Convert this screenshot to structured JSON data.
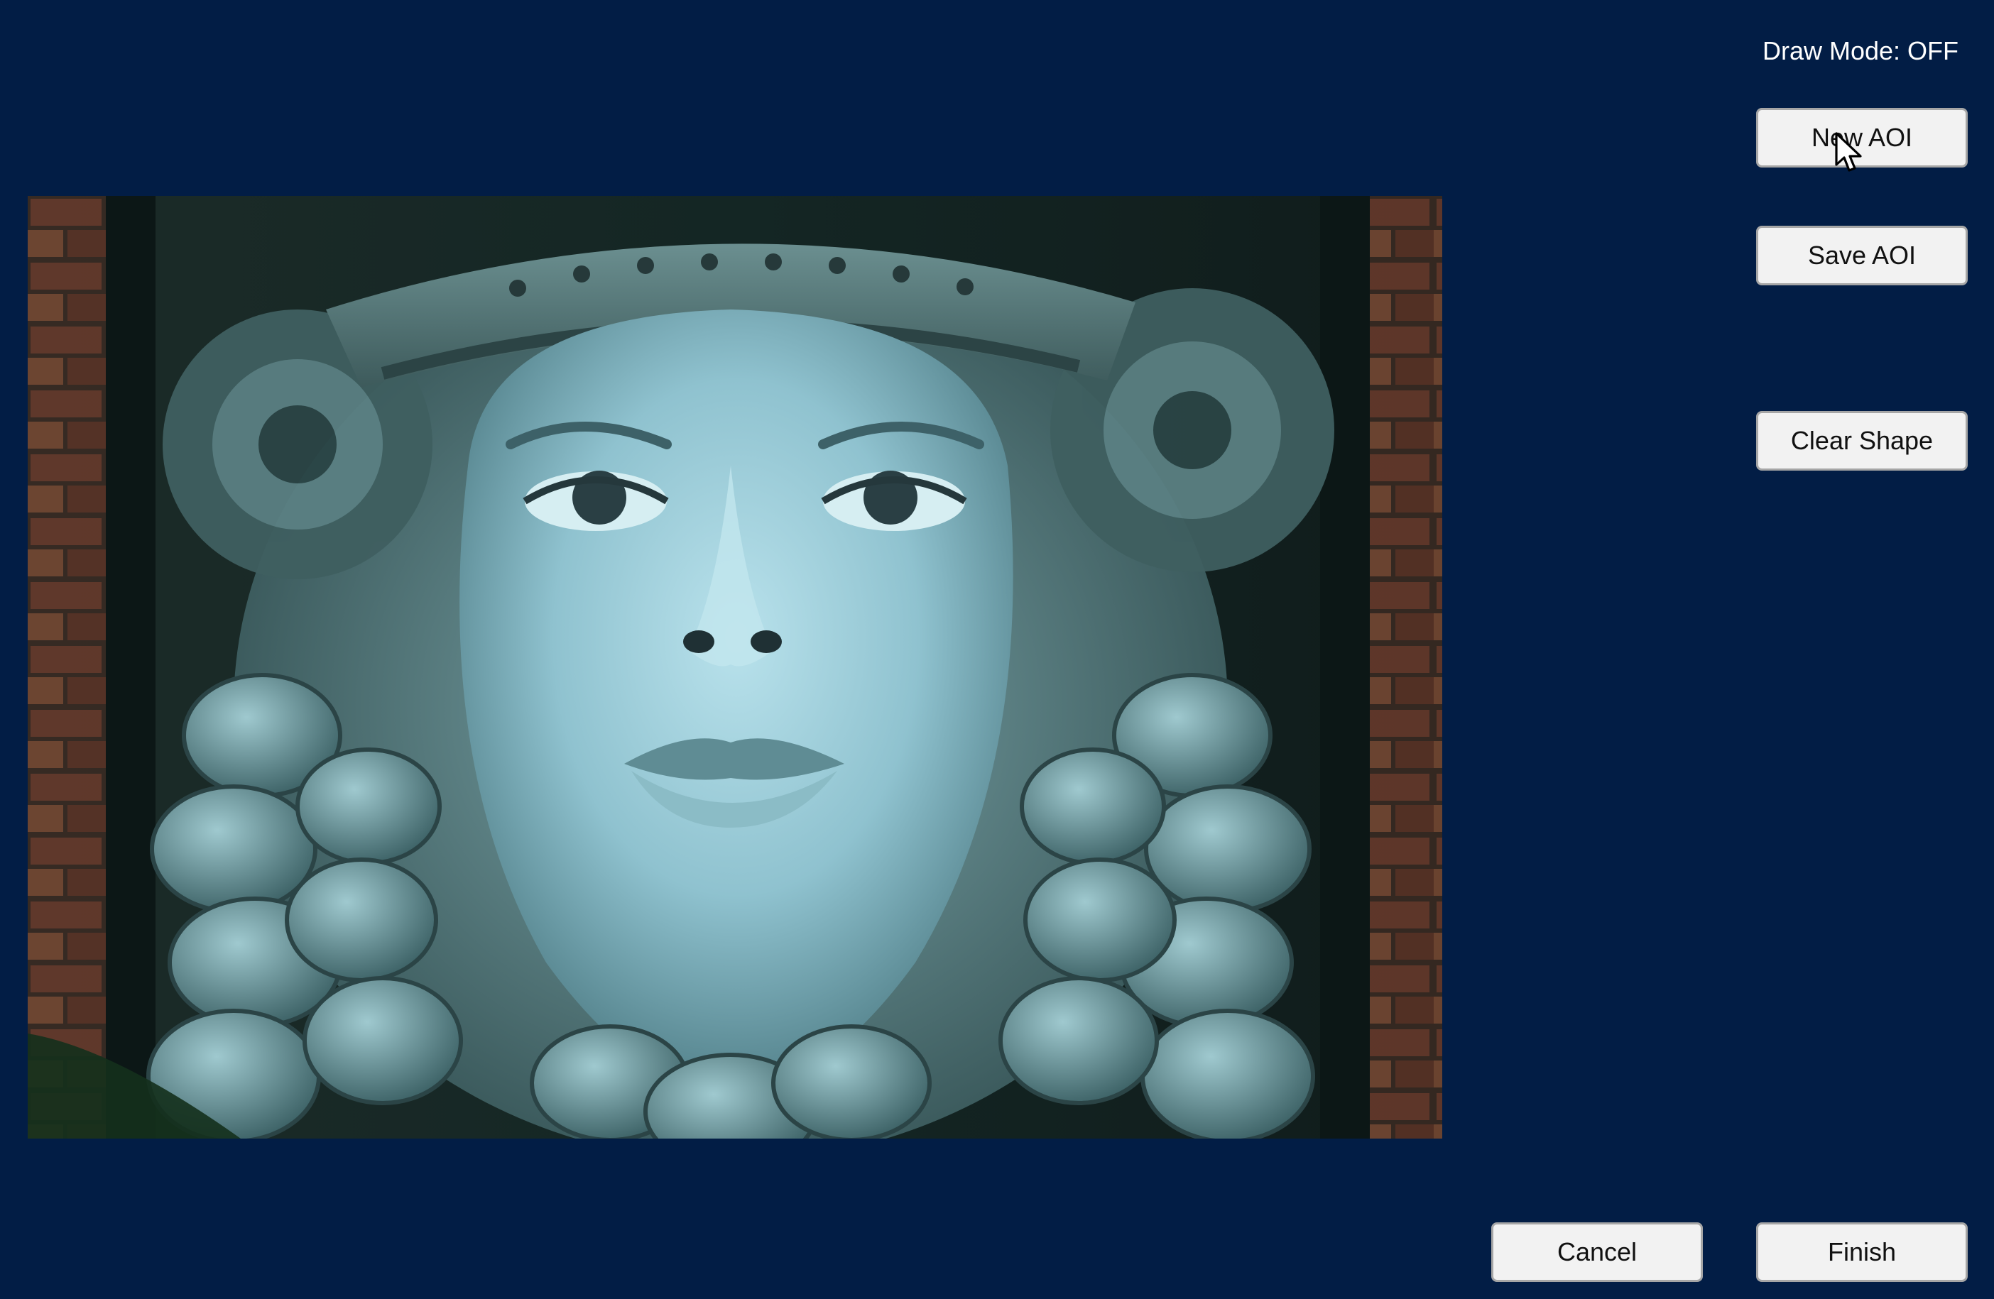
{
  "status": {
    "draw_mode": "Draw Mode: OFF"
  },
  "toolbar": {
    "new_aoi_label": "New AOI",
    "save_aoi_label": "Save AOI",
    "clear_shape_label": "Clear Shape"
  },
  "footer": {
    "cancel_label": "Cancel",
    "finish_label": "Finish"
  },
  "image": {
    "subject": "carved stone sculpture of a woman's face with flower crown and braided hair, brick wall background"
  },
  "colors": {
    "background": "#021d45",
    "button_face": "#f2f2f2",
    "button_border": "#a6a6a6"
  }
}
